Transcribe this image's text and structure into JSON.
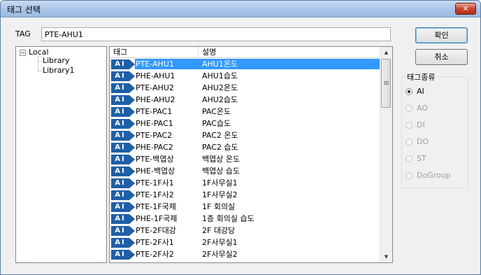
{
  "window": {
    "title": "태그 선택",
    "close_label": "✕"
  },
  "tag": {
    "label": "TAG",
    "value": "PTE-AHU1"
  },
  "tree": {
    "root_expander": "−",
    "root_label": "Local",
    "children": [
      "Library",
      "Library1"
    ]
  },
  "list": {
    "columns": [
      "태그",
      "설명"
    ],
    "badge_text": "AI",
    "rows": [
      {
        "tag": "PTE-AHU1",
        "desc": "AHU1온도",
        "selected": true
      },
      {
        "tag": "PHE-AHU1",
        "desc": "AHU1습도"
      },
      {
        "tag": "PTE-AHU2",
        "desc": "AHU2온도"
      },
      {
        "tag": "PHE-AHU2",
        "desc": "AHU2습도"
      },
      {
        "tag": "PTE-PAC1",
        "desc": "PAC온도"
      },
      {
        "tag": "PHE-PAC1",
        "desc": "PAC습도"
      },
      {
        "tag": "PTE-PAC2",
        "desc": "PAC2 온도"
      },
      {
        "tag": "PHE-PAC2",
        "desc": "PAC2 습도"
      },
      {
        "tag": "PTE-백엽상",
        "desc": "백엽상 온도"
      },
      {
        "tag": "PHE-백엽상",
        "desc": "백엽상 습도"
      },
      {
        "tag": "PTE-1F사1",
        "desc": "1F사무실1"
      },
      {
        "tag": "PTE-1F사2",
        "desc": "1F사무실2"
      },
      {
        "tag": "PTE-1F국제",
        "desc": "1F 회의실"
      },
      {
        "tag": "PHE-1F국제",
        "desc": "1층 회의실 습도"
      },
      {
        "tag": "PTE-2F대강",
        "desc": "2F 대강당"
      },
      {
        "tag": "PTE-2F사1",
        "desc": "2F사무실1"
      },
      {
        "tag": "PTE-2F사2",
        "desc": "2F사무실2"
      }
    ]
  },
  "scrollbar": {
    "up_icon": "▲",
    "down_icon": "▼"
  },
  "buttons": {
    "ok": "확인",
    "cancel": "취소"
  },
  "tag_type": {
    "label": "태그종류",
    "options": [
      {
        "label": "AI",
        "checked": true,
        "enabled": true
      },
      {
        "label": "AO",
        "checked": false,
        "enabled": false
      },
      {
        "label": "DI",
        "checked": false,
        "enabled": false
      },
      {
        "label": "DO",
        "checked": false,
        "enabled": false
      },
      {
        "label": "ST",
        "checked": false,
        "enabled": false
      },
      {
        "label": "DoGroup",
        "checked": false,
        "enabled": false
      }
    ]
  },
  "colors": {
    "selection": "#3399ff",
    "badge": "#1f5fa6"
  }
}
